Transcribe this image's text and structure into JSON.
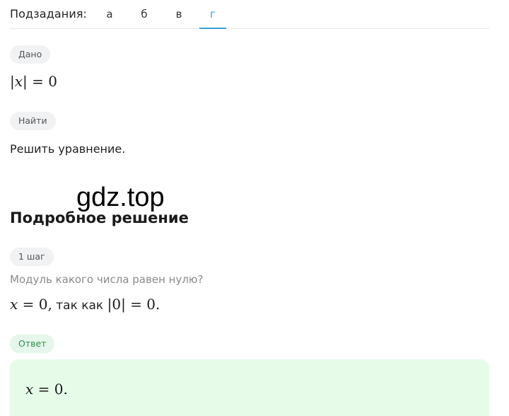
{
  "subtasks": {
    "label": "Подзадания:",
    "tabs": [
      {
        "label": "а",
        "active": false
      },
      {
        "label": "б",
        "active": false
      },
      {
        "label": "в",
        "active": false
      },
      {
        "label": "г",
        "active": true
      }
    ],
    "accent_color": "#3aa0d8"
  },
  "given": {
    "pill": "Дано",
    "formula": {
      "open": "|",
      "var": "x",
      "close": "|",
      "rest": " = 0"
    }
  },
  "find": {
    "pill": "Найти",
    "text": "Решить уравнение."
  },
  "watermark": "gdz.top",
  "solution": {
    "title": "Подробное решение",
    "step_pill": "1 шаг",
    "question": "Модуль какого числа равен нулю?",
    "line": {
      "var": "x",
      "eq": " = 0,",
      "text": " так как ",
      "abs": "|0| = 0."
    }
  },
  "answer": {
    "pill": "Ответ",
    "formula": {
      "var": "x",
      "rest": " = 0."
    },
    "bg_color": "#e7fbe9"
  }
}
